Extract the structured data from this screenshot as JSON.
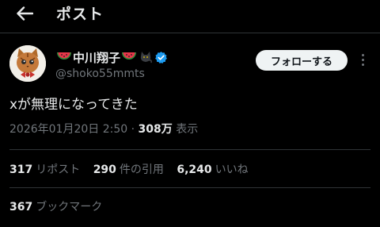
{
  "header": {
    "title": "ポスト",
    "back_icon": "arrow-left-icon"
  },
  "author": {
    "display_name": "中川翔子",
    "handle": "@shoko55mmts",
    "verified": true,
    "name_emojis": [
      "watermelon",
      "watermelon",
      "black-cat"
    ],
    "avatar_icon": "cat-avatar"
  },
  "follow_button": {
    "label": "フォローする"
  },
  "more_icon": "more-vertical-icon",
  "post": {
    "text": "xが無理になってきた",
    "timestamp": "2026年01月20日 2:50",
    "separator": " · ",
    "views_count": "308万",
    "views_label": " 表示"
  },
  "stats": {
    "reposts_count": "317",
    "reposts_label": "リポスト",
    "quotes_count": "290",
    "quotes_label": "件の引用",
    "likes_count": "6,240",
    "likes_label": "いいね",
    "bookmarks_count": "367",
    "bookmarks_label": "ブックマーク"
  },
  "colors": {
    "background": "#000000",
    "text_primary": "#e7e9ea",
    "text_secondary": "#71767b",
    "divider": "#2f3336",
    "verified_blue": "#1d9bf0",
    "follow_button_bg": "#eff3f4"
  }
}
